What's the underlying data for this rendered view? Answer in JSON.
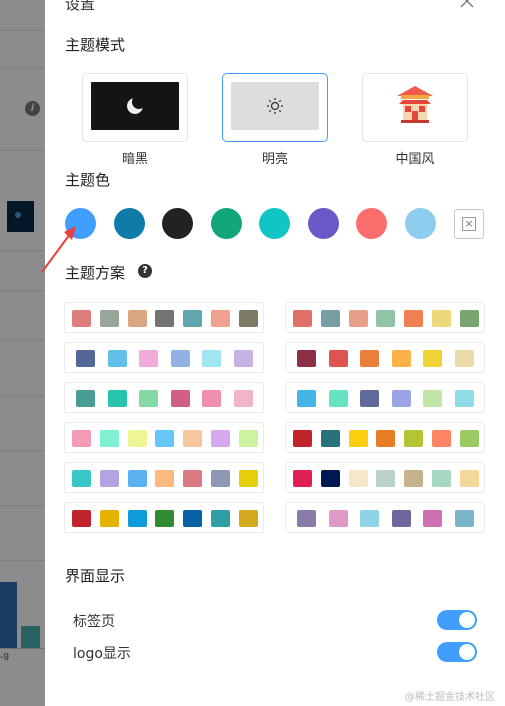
{
  "drawer": {
    "title": "设置",
    "close_icon": "close-icon"
  },
  "theme_mode": {
    "title": "主题模式",
    "options": [
      {
        "label": "暗黑",
        "icon": "moon-icon",
        "bg": "#141414"
      },
      {
        "label": "明亮",
        "icon": "sun-icon",
        "bg": "#dcdcdc",
        "selected": true
      },
      {
        "label": "中国风",
        "icon": "chinese-building-icon",
        "bg": "#ffffff"
      }
    ]
  },
  "theme_color": {
    "title": "主题色",
    "colors": [
      "#409eff",
      "#0e7ba9",
      "#222222",
      "#13a67a",
      "#12c5c5",
      "#6b57c8",
      "#fc6d6d",
      "#8ccdee"
    ],
    "custom_icon": "close-square-icon"
  },
  "theme_scheme": {
    "title": "主题方案",
    "help_icon": "question-icon",
    "palettes_left": [
      [
        "#de7d7d",
        "#98a69a",
        "#d8a680",
        "#737373",
        "#5fa6ad",
        "#f0a18f",
        "#7b7b65"
      ],
      [
        "#536897",
        "#62c0e8",
        "#f1aad9",
        "#8fb3e4",
        "#9fe6f0",
        "#c6b0e4"
      ],
      [
        "#4a9d93",
        "#27c3ad",
        "#85d9a4",
        "#d15f83",
        "#f18faf",
        "#f2b5c8"
      ],
      [
        "#f49ab5",
        "#80f0d4",
        "#eef593",
        "#66c6f5",
        "#f6c79c",
        "#d6a9ef",
        "#cdf2a0"
      ],
      [
        "#37c7c7",
        "#b4a3e3",
        "#5ab1ef",
        "#ffb980",
        "#d87a80",
        "#8d98b3",
        "#e5cf0d"
      ],
      [
        "#c1232b",
        "#e3b300",
        "#0f9ad9",
        "#318a2f",
        "#0861a6",
        "#319da4",
        "#d2aa1e"
      ]
    ],
    "palettes_right": [
      [
        "#e07067",
        "#789ea3",
        "#e89f87",
        "#91c3a7",
        "#ee8054",
        "#eed97a",
        "#76a66e"
      ],
      [
        "#8c2f47",
        "#de5550",
        "#ea7f3c",
        "#fdb247",
        "#f0d437",
        "#eadaa8"
      ],
      [
        "#43b4e6",
        "#66e3c0",
        "#5f6a9a",
        "#9ba4e5",
        "#c2e6a8",
        "#90dce6"
      ],
      [
        "#c1232b",
        "#27727b",
        "#fcce10",
        "#e87c25",
        "#b5c334",
        "#fe8463",
        "#9bca63"
      ],
      [
        "#e01f54",
        "#001852",
        "#f5e8c8",
        "#b8d2c7",
        "#c6b38e",
        "#a4d8c2",
        "#f3d999"
      ],
      [
        "#8a7ca8",
        "#e098c7",
        "#8fd3e8",
        "#71669e",
        "#cc70af",
        "#7cb4cc"
      ]
    ]
  },
  "display": {
    "title": "界面显示",
    "toggles": [
      {
        "label": "标签页",
        "on": true
      },
      {
        "label": "logo显示",
        "on": true
      }
    ]
  },
  "background": {
    "tick_label": "-9",
    "info_icon": "info-icon"
  },
  "watermark": "@稀土掘金技术社区",
  "colors": {
    "accent": "#409eff",
    "overlay": "rgba(0,0,0,0.45)",
    "annotation_arrow": "#e8403a"
  }
}
